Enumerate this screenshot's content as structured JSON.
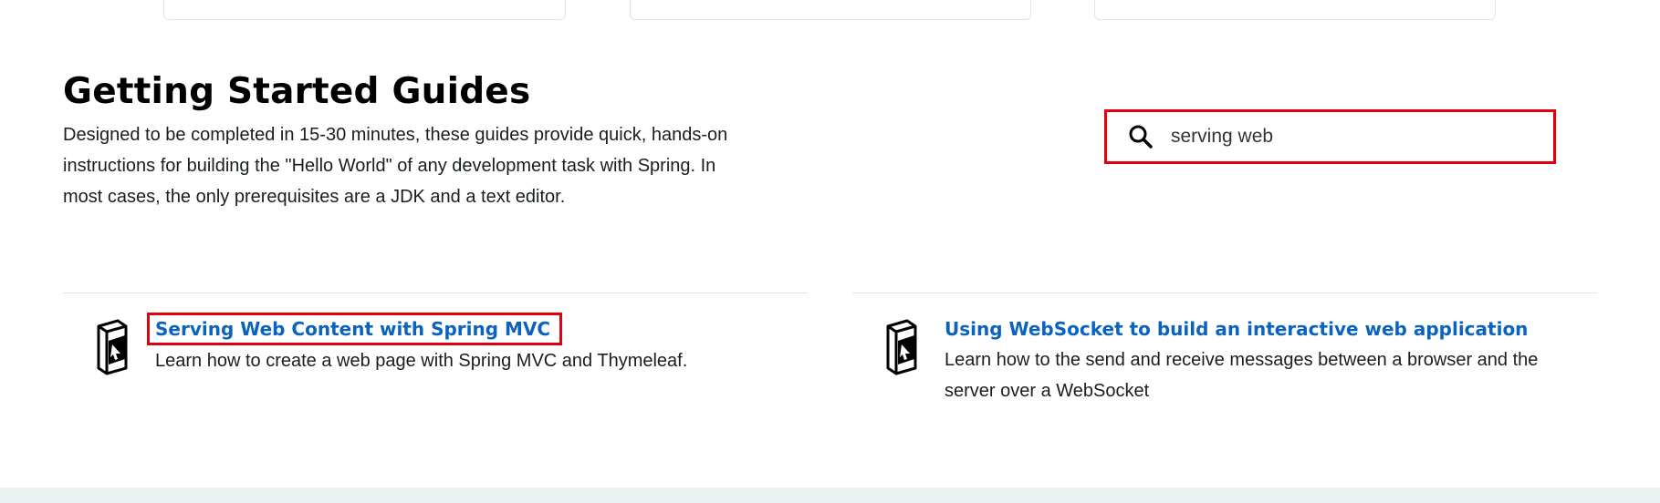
{
  "header": {
    "title": "Getting Started Guides",
    "description": "Designed to be completed in 15-30 minutes, these guides provide quick, hands-on instructions for building the \"Hello World\" of any development task with Spring. In most cases, the only prerequisites are a JDK and a text editor."
  },
  "search": {
    "icon": "search-icon",
    "value": "serving web",
    "border_color": "#e0000f"
  },
  "results": [
    {
      "icon": "guide-book-icon",
      "title": "Serving Web Content with Spring MVC",
      "description": "Learn how to create a web page with Spring MVC and Thymeleaf."
    },
    {
      "icon": "guide-book-icon",
      "title": "Using WebSocket to build an interactive web application",
      "description": "Learn how to the send and receive messages between a browser and the server over a WebSocket"
    }
  ],
  "colors": {
    "link": "#0b63c0",
    "highlight": "#e0000f",
    "footer_band": "#ebf2f2"
  }
}
